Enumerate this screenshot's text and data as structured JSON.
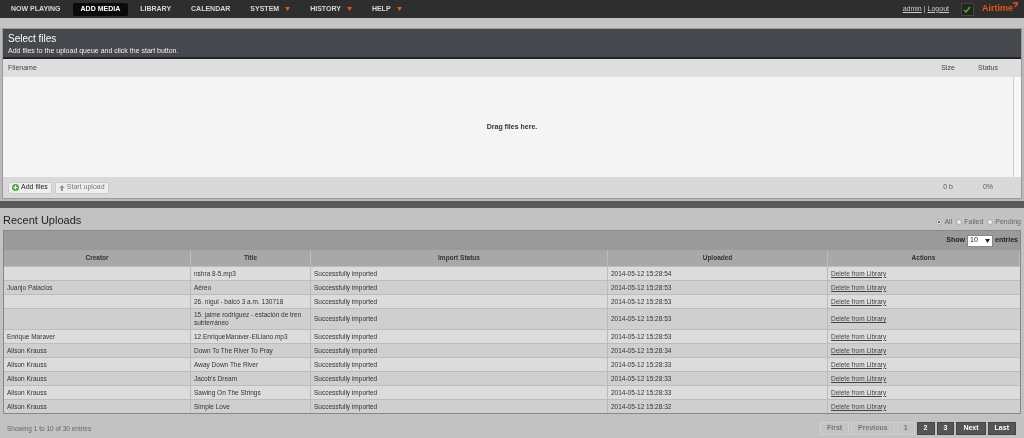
{
  "nav": {
    "items": [
      {
        "label": "NOW PLAYING",
        "selected": false,
        "has_menu": false
      },
      {
        "label": "ADD MEDIA",
        "selected": true,
        "has_menu": false
      },
      {
        "label": "LIBRARY",
        "selected": false,
        "has_menu": false
      },
      {
        "label": "CALENDAR",
        "selected": false,
        "has_menu": false
      },
      {
        "label": "SYSTEM",
        "selected": false,
        "has_menu": true
      },
      {
        "label": "HISTORY",
        "selected": false,
        "has_menu": true
      },
      {
        "label": "HELP",
        "selected": false,
        "has_menu": true
      }
    ],
    "user": "admin",
    "separator": "|",
    "logout": "Logout",
    "brand": "Airtime"
  },
  "upload": {
    "title": "Select files",
    "subtitle": "Add files to the upload queue and click the start button.",
    "columns": [
      "Filename",
      "Size",
      "Status"
    ],
    "drop_hint": "Drag files here.",
    "buttons": [
      {
        "label": "Add files",
        "disabled": false
      },
      {
        "label": "Start upload",
        "disabled": true
      }
    ],
    "total_size": "0 b",
    "total_status": "0%"
  },
  "recent": {
    "title": "Recent Uploads",
    "filters": [
      {
        "label": "All",
        "selected": true
      },
      {
        "label": "Failed",
        "selected": false
      },
      {
        "label": "Pending",
        "selected": false
      }
    ],
    "show_label": "Show",
    "page_size": "10",
    "entries_label": "entries",
    "columns": [
      "Creator",
      "Title",
      "Import Status",
      "Uploaded",
      "Actions"
    ],
    "rows": [
      {
        "creator": "",
        "title": "nshra 8-5.mp3",
        "status": "Successfully imported",
        "uploaded": "2014-05-12 15:28:54",
        "action": "Delete from Library"
      },
      {
        "creator": "Juanjo Palacios",
        "title": "Aéreo",
        "status": "Successfully imported",
        "uploaded": "2014-05-12 15:28:53",
        "action": "Delete from Library"
      },
      {
        "creator": "",
        "title": "26. nigul - balcó 3 a.m. 130718",
        "status": "Successfully imported",
        "uploaded": "2014-05-12 15:28:53",
        "action": "Delete from Library"
      },
      {
        "creator": "",
        "title": "15. jaime rodriguez - estación de tren subterráneo",
        "status": "Successfully imported",
        "uploaded": "2014-05-12 15:28:53",
        "action": "Delete from Library"
      },
      {
        "creator": "Enrique Maraver",
        "title": "12.EnriqueMaraver-ElLlano.mp3",
        "status": "Successfully imported",
        "uploaded": "2014-05-12 15:28:53",
        "action": "Delete from Library"
      },
      {
        "creator": "Alison Krauss",
        "title": "Down To The River To Pray",
        "status": "Successfully imported",
        "uploaded": "2014-05-12 15:28:34",
        "action": "Delete from Library"
      },
      {
        "creator": "Alison Krauss",
        "title": "Away Down The River",
        "status": "Successfully imported",
        "uploaded": "2014-05-12 15:28:33",
        "action": "Delete from Library"
      },
      {
        "creator": "Alison Krauss",
        "title": "Jacob's Dream",
        "status": "Successfully imported",
        "uploaded": "2014-05-12 15:28:33",
        "action": "Delete from Library"
      },
      {
        "creator": "Alison Krauss",
        "title": "Sawing On The Strings",
        "status": "Successfully imported",
        "uploaded": "2014-05-12 15:28:33",
        "action": "Delete from Library"
      },
      {
        "creator": "Alison Krauss",
        "title": "Simple Love",
        "status": "Successfully imported",
        "uploaded": "2014-05-12 15:28:32",
        "action": "Delete from Library"
      }
    ],
    "info": "Showing 1 to 10 of 30 entries",
    "pagination": [
      {
        "label": "First",
        "disabled": true
      },
      {
        "label": "Previous",
        "disabled": true
      },
      {
        "label": "1",
        "disabled": true
      },
      {
        "label": "2",
        "disabled": false
      },
      {
        "label": "3",
        "disabled": false
      },
      {
        "label": "Next",
        "disabled": false
      },
      {
        "label": "Last",
        "disabled": false
      }
    ]
  }
}
